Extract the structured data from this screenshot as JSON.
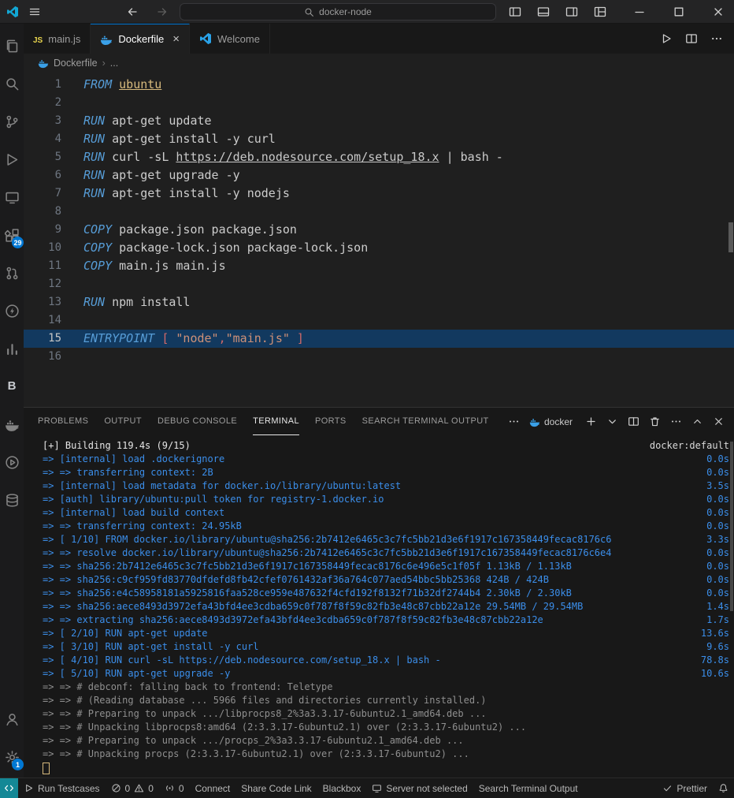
{
  "colors": {
    "accent": "#0078d4",
    "badge": "#0078d4",
    "keyword": "#569cd6",
    "string": "#ce9178",
    "terminal_blue": "#3b8eea",
    "remote": "#148896"
  },
  "titlebar": {
    "search": "docker-node"
  },
  "editor_tabs": [
    {
      "label": "main.js",
      "icon": "js",
      "active": false
    },
    {
      "label": "Dockerfile",
      "icon": "docker",
      "active": true
    },
    {
      "label": "Welcome",
      "icon": "vscode",
      "active": false
    }
  ],
  "breadcrumb": {
    "file": "Dockerfile",
    "separator": "›",
    "rest": "..."
  },
  "activity_bar": {
    "top": [
      {
        "icon": "explorer",
        "name": "explorer"
      },
      {
        "icon": "search",
        "name": "search"
      },
      {
        "icon": "source-control",
        "name": "source-control"
      },
      {
        "icon": "run-debug",
        "name": "run-and-debug"
      },
      {
        "icon": "remote-explorer",
        "name": "remote-explorer"
      },
      {
        "icon": "extensions",
        "name": "extensions",
        "badge": "29"
      },
      {
        "icon": "pull-request",
        "name": "pull-requests"
      },
      {
        "icon": "bolt",
        "name": "thunder-client"
      },
      {
        "icon": "bar-chart",
        "name": "profiler"
      },
      {
        "icon": "letter-b",
        "name": "blackbox"
      },
      {
        "icon": "docker",
        "name": "docker"
      },
      {
        "icon": "circle-play",
        "name": "code-runner"
      },
      {
        "icon": "database",
        "name": "database"
      }
    ],
    "bottom": [
      {
        "icon": "account",
        "name": "accounts"
      },
      {
        "icon": "gear",
        "name": "settings",
        "badge": "1"
      }
    ]
  },
  "editor": {
    "lines": [
      {
        "n": 1,
        "tk": [
          [
            "k",
            "FROM"
          ],
          [
            "t",
            " "
          ],
          [
            "i",
            "ubuntu"
          ]
        ]
      },
      {
        "n": 2,
        "tk": []
      },
      {
        "n": 3,
        "tk": [
          [
            "k",
            "RUN"
          ],
          [
            "t",
            " apt-get update"
          ]
        ]
      },
      {
        "n": 4,
        "tk": [
          [
            "k",
            "RUN"
          ],
          [
            "t",
            " apt-get install -y curl"
          ]
        ]
      },
      {
        "n": 5,
        "tk": [
          [
            "k",
            "RUN"
          ],
          [
            "t",
            " curl -sL "
          ],
          [
            "u",
            "https://deb.nodesource.com/setup_18.x"
          ],
          [
            "t",
            " | bash -"
          ]
        ]
      },
      {
        "n": 6,
        "tk": [
          [
            "k",
            "RUN"
          ],
          [
            "t",
            " apt-get upgrade -y"
          ]
        ]
      },
      {
        "n": 7,
        "tk": [
          [
            "k",
            "RUN"
          ],
          [
            "t",
            " apt-get install -y nodejs"
          ]
        ]
      },
      {
        "n": 8,
        "tk": []
      },
      {
        "n": 9,
        "tk": [
          [
            "k",
            "COPY"
          ],
          [
            "t",
            " package.json package.json"
          ]
        ]
      },
      {
        "n": 10,
        "tk": [
          [
            "k",
            "COPY"
          ],
          [
            "t",
            " package-lock.json package-lock.json"
          ]
        ]
      },
      {
        "n": 11,
        "tk": [
          [
            "k",
            "COPY"
          ],
          [
            "t",
            " main.js main.js"
          ]
        ]
      },
      {
        "n": 12,
        "tk": []
      },
      {
        "n": 13,
        "tk": [
          [
            "k",
            "RUN"
          ],
          [
            "t",
            " npm install"
          ]
        ]
      },
      {
        "n": 14,
        "tk": []
      },
      {
        "n": 15,
        "hl": true,
        "tk": [
          [
            "k",
            "ENTRYPOINT"
          ],
          [
            "t",
            " "
          ],
          [
            "b",
            "[ "
          ],
          [
            "s",
            "\"node\""
          ],
          [
            "b",
            ","
          ],
          [
            "s",
            "\"main.js\""
          ],
          [
            "b",
            " ]"
          ]
        ]
      },
      {
        "n": 16,
        "tk": []
      }
    ]
  },
  "panel": {
    "tabs": [
      {
        "label": "PROBLEMS"
      },
      {
        "label": "OUTPUT"
      },
      {
        "label": "DEBUG CONSOLE"
      },
      {
        "label": "TERMINAL",
        "active": true
      },
      {
        "label": "PORTS"
      },
      {
        "label": "SEARCH TERMINAL OUTPUT"
      }
    ],
    "profile": {
      "label": "docker"
    },
    "actions": [
      {
        "icon": "plus",
        "name": "new-terminal"
      },
      {
        "icon": "chevron-down",
        "name": "terminal-profiles-dropdown"
      },
      {
        "icon": "split",
        "name": "split-terminal"
      },
      {
        "icon": "trash",
        "name": "kill-terminal"
      },
      {
        "icon": "ellipsis",
        "name": "terminal-more-actions"
      },
      {
        "icon": "chevron-up",
        "name": "maximize-panel"
      },
      {
        "icon": "close",
        "name": "close-panel"
      }
    ]
  },
  "terminal": {
    "lines": [
      {
        "t": "[+] Building 119.4s (9/15)",
        "c": "head",
        "r": "docker:default"
      },
      {
        "t": "=> [internal] load .dockerignore",
        "c": "blue",
        "r": "0.0s"
      },
      {
        "t": "=> => transferring context: 2B",
        "c": "blue",
        "r": "0.0s"
      },
      {
        "t": "=> [internal] load metadata for docker.io/library/ubuntu:latest",
        "c": "blue",
        "r": "3.5s"
      },
      {
        "t": "=> [auth] library/ubuntu:pull token for registry-1.docker.io",
        "c": "blue",
        "r": "0.0s"
      },
      {
        "t": "=> [internal] load build context",
        "c": "blue",
        "r": "0.0s"
      },
      {
        "t": "=> => transferring context: 24.95kB",
        "c": "blue",
        "r": "0.0s"
      },
      {
        "t": "=> [ 1/10] FROM docker.io/library/ubuntu@sha256:2b7412e6465c3c7fc5bb21d3e6f1917c167358449fecac8176c6",
        "c": "blue",
        "r": "3.3s"
      },
      {
        "t": "=> => resolve docker.io/library/ubuntu@sha256:2b7412e6465c3c7fc5bb21d3e6f1917c167358449fecac8176c6e4",
        "c": "blue",
        "r": "0.0s"
      },
      {
        "t": "=> => sha256:2b7412e6465c3c7fc5bb21d3e6f1917c167358449fecac8176c6e496e5c1f05f 1.13kB / 1.13kB",
        "c": "blue",
        "r": "0.0s"
      },
      {
        "t": "=> => sha256:c9cf959fd83770dfdefd8fb42cfef0761432af36a764c077aed54bbc5bb25368 424B / 424B",
        "c": "blue",
        "r": "0.0s"
      },
      {
        "t": "=> => sha256:e4c58958181a5925816faa528ce959e487632f4cfd192f8132f71b32df2744b4 2.30kB / 2.30kB",
        "c": "blue",
        "r": "0.0s"
      },
      {
        "t": "=> => sha256:aece8493d3972efa43bfd4ee3cdba659c0f787f8f59c82fb3e48c87cbb22a12e 29.54MB / 29.54MB",
        "c": "blue",
        "r": "1.4s"
      },
      {
        "t": "=> => extracting sha256:aece8493d3972efa43bfd4ee3cdba659c0f787f8f59c82fb3e48c87cbb22a12e",
        "c": "blue",
        "r": "1.7s"
      },
      {
        "t": "=> [ 2/10] RUN apt-get update",
        "c": "blue",
        "r": "13.6s"
      },
      {
        "t": "=> [ 3/10] RUN apt-get install -y curl",
        "c": "blue",
        "r": "9.6s"
      },
      {
        "t": "=> [ 4/10] RUN curl -sL https://deb.nodesource.com/setup_18.x | bash -",
        "c": "blue",
        "r": "78.8s"
      },
      {
        "t": "=> [ 5/10] RUN apt-get upgrade -y",
        "c": "blue",
        "r": "10.6s"
      },
      {
        "t": "=> => # debconf: falling back to frontend: Teletype",
        "c": "dim"
      },
      {
        "t": "=> => # (Reading database ... 5966 files and directories currently installed.)",
        "c": "dim"
      },
      {
        "t": "=> => # Preparing to unpack .../libprocps8_2%3a3.3.17-6ubuntu2.1_amd64.deb ...",
        "c": "dim"
      },
      {
        "t": "=> => # Unpacking libprocps8:amd64 (2:3.3.17-6ubuntu2.1) over (2:3.3.17-6ubuntu2) ...",
        "c": "dim"
      },
      {
        "t": "=> => # Preparing to unpack .../procps_2%3a3.3.17-6ubuntu2.1_amd64.deb ...",
        "c": "dim"
      },
      {
        "t": "=> => # Unpacking procps (2:3.3.17-6ubuntu2.1) over (2:3.3.17-6ubuntu2) ...",
        "c": "dim"
      }
    ]
  },
  "status_bar": {
    "left": [
      {
        "icon": "remote",
        "name": "remote-indicator",
        "accent": true
      },
      {
        "icon": "play",
        "label": "Run Testcases",
        "name": "run-testcases"
      },
      {
        "icon": "error",
        "label": "0",
        "icon2": "warning",
        "label2": "0",
        "name": "problems-indicator"
      },
      {
        "icon": "broadcast",
        "label": "0",
        "name": "ports-indicator"
      },
      {
        "label": "Connect",
        "name": "connect"
      },
      {
        "label": "Share Code Link",
        "name": "share-code-link"
      },
      {
        "label": "Blackbox",
        "name": "blackbox"
      },
      {
        "icon": "server",
        "label": "Server not selected",
        "name": "server-status"
      },
      {
        "label": "Search Terminal Output",
        "name": "search-terminal-output"
      }
    ],
    "right": [
      {
        "icon": "check",
        "label": "Prettier",
        "name": "prettier"
      },
      {
        "icon": "bell",
        "name": "notifications"
      }
    ]
  }
}
